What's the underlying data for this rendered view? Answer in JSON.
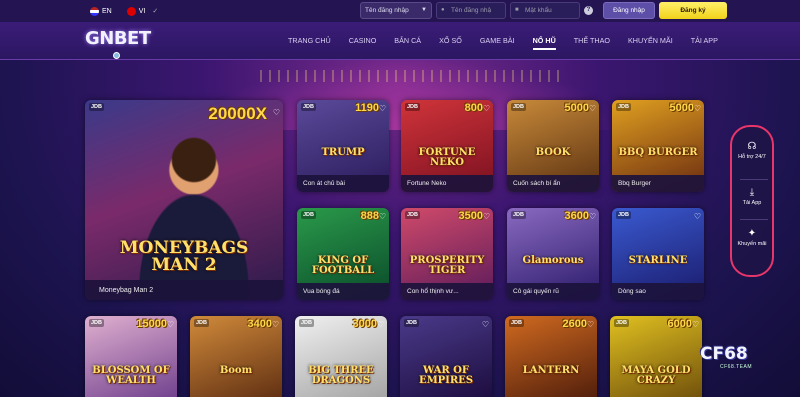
{
  "topbar": {
    "lang_en": "EN",
    "lang_vi": "VI",
    "username_select": "Tên đăng nhập",
    "username_placeholder": "Tên đăng nhậ",
    "password_placeholder": "Mật khẩu",
    "login_button": "Đăng nhập",
    "register_button": "Đăng ký"
  },
  "nav": {
    "logo": "GNBET",
    "items": [
      "TRANG CHỦ",
      "CASINO",
      "BẮN CÁ",
      "XỔ SỐ",
      "GAME BÀI",
      "NỔ HŨ",
      "THỂ THAO",
      "KHUYẾN MÃI",
      "TẢI APP"
    ],
    "active_index": 5
  },
  "featured": {
    "provider": "JDB",
    "jackpot": "20000X",
    "art_title": "MONEYBAGS MAN 2",
    "caption": "Moneybag Man 2"
  },
  "games": [
    {
      "provider": "JDB",
      "jackpot": "1190",
      "art": "TRUMP",
      "caption": "Con át chủ bài"
    },
    {
      "provider": "JDB",
      "jackpot": "800",
      "art": "FORTUNE NEKO",
      "caption": "Fortune Neko"
    },
    {
      "provider": "JDB",
      "jackpot": "5000",
      "art": "BOOK",
      "caption": "Cuốn sách bí ẩn"
    },
    {
      "provider": "JDB",
      "jackpot": "5000",
      "art": "BBQ BURGER",
      "caption": "Bbq Burger"
    },
    {
      "provider": "JDB",
      "jackpot": "888",
      "art": "KING OF FOOTBALL",
      "caption": "Vua bóng đá"
    },
    {
      "provider": "JDB",
      "jackpot": "3500",
      "art": "PROSPERITY TIGER",
      "caption": "Con hổ thịnh vư..."
    },
    {
      "provider": "JDB",
      "jackpot": "3600",
      "art": "Glamorous",
      "caption": "Cô gái quyến rũ"
    },
    {
      "provider": "JDB",
      "jackpot": "",
      "art": "STARLINE",
      "caption": "Dòng sao"
    },
    {
      "provider": "JDB",
      "jackpot": "15000",
      "art": "BLOSSOM OF WEALTH",
      "caption": ""
    },
    {
      "provider": "JDB",
      "jackpot": "3400",
      "art": "Boom",
      "caption": ""
    },
    {
      "provider": "JDB",
      "jackpot": "3000",
      "art": "BIG THREE DRAGONS",
      "caption": ""
    },
    {
      "provider": "JDB",
      "jackpot": "",
      "art": "WAR OF EMPIRES",
      "caption": ""
    },
    {
      "provider": "JDB",
      "jackpot": "2600",
      "art": "LANTERN",
      "caption": ""
    },
    {
      "provider": "JDB",
      "jackpot": "6000",
      "art": "MAYA GOLD CRAZY",
      "caption": ""
    }
  ],
  "side_panel": {
    "support": "Hỗ trợ 24/7",
    "app": "Tải App",
    "promo": "Khuyến mãi"
  },
  "watermark": {
    "brand": "CF68",
    "sub": "CF68.TEAM"
  },
  "colors": {
    "accent_yellow": "#f1d21a",
    "panel_border": "#e8356a",
    "nav_bg": "#3b1c78"
  }
}
